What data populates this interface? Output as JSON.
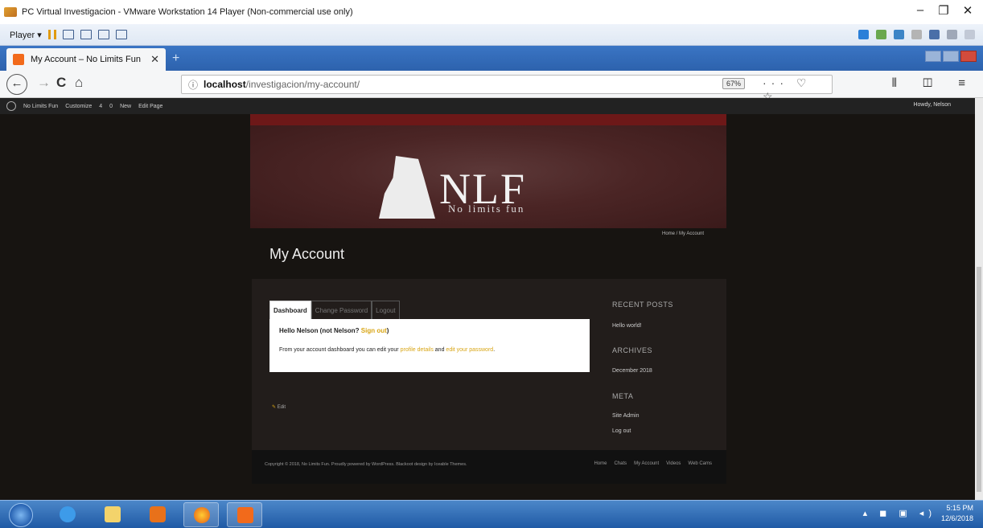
{
  "vm": {
    "title": "PC Virtual Investigacion - VMware Workstation 14 Player (Non-commercial use only)",
    "player_label": "Player ▾",
    "controls": {
      "minimize": "–",
      "restore": "❐",
      "close": "✕"
    }
  },
  "browser": {
    "tab_title": "My Account – No Limits Fun",
    "tab_close": "✕",
    "new_tab": "+",
    "url_info": "ⓘ",
    "url_host": "localhost",
    "url_path": "/investigacion/my-account/",
    "zoom": "67%",
    "url_actions": "··· ♡ ☆",
    "nav_right": "⫴ ◫ ≡",
    "back": "←",
    "forward": "→",
    "reload": "C",
    "home": "⌂"
  },
  "wp_admin_bar": {
    "site": "No Limits Fun",
    "customize": "Customize",
    "updates": "4",
    "comments": "0",
    "new": "New",
    "edit_page": "Edit Page",
    "howdy": "Howdy, Nelson"
  },
  "site": {
    "logo_text": "NLF",
    "logo_sub": "No limits fun",
    "breadcrumb": "Home / My Account",
    "page_title": "My Account",
    "tabs": [
      "Dashboard",
      "Change Password",
      "Logout"
    ],
    "greeting_prefix": "Hello Nelson (not Nelson? ",
    "greeting_link": "Sign out",
    "greeting_suffix": ")",
    "dash_prefix": "From your account dashboard you can edit your ",
    "dash_link1": "profile details",
    "dash_mid": " and ",
    "dash_link2": "edit your password",
    "dash_suffix": ".",
    "edit": "Edit",
    "widgets": {
      "recent_posts_title": "RECENT POSTS",
      "recent_post": "Hello world!",
      "archives_title": "ARCHIVES",
      "archive": "December 2018",
      "meta_title": "META",
      "meta_links": [
        "Site Admin",
        "Log out"
      ]
    },
    "footer": {
      "copyright": "Copyright © 2018, No Limits Fun. Proudly powered by WordPress. Blackoot design by Iceable Themes.",
      "nav": [
        "Home",
        "Chats",
        "My Account",
        "Videos",
        "Web Cams"
      ]
    }
  },
  "taskbar": {
    "time": "5:15 PM",
    "date": "12/6/2018"
  }
}
